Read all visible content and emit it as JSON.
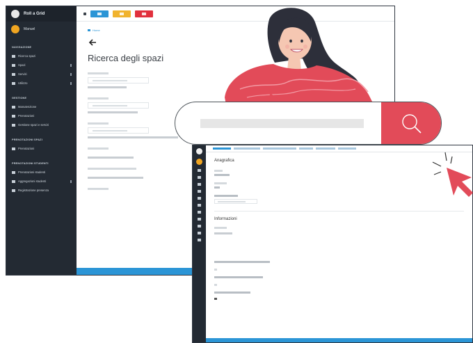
{
  "app": {
    "name": "Roll a Grid"
  },
  "user": {
    "name": "Manuel"
  },
  "sidebar": {
    "sections": [
      {
        "title": "NAVIGAZIONE",
        "items": [
          {
            "label": "Ricerca spazi"
          },
          {
            "label": "Spazi"
          },
          {
            "label": "Servizi"
          },
          {
            "label": "Utilizzo"
          }
        ]
      },
      {
        "title": "GESTIONE",
        "items": [
          {
            "label": "Manutenzione"
          },
          {
            "label": "Prenotazioni"
          },
          {
            "label": "Gestione spazi e servizi"
          }
        ]
      },
      {
        "title": "PRENOTAZIONI SPAZI",
        "items": [
          {
            "label": "Prenotazioni"
          }
        ]
      },
      {
        "title": "PRENOTAZIONI STUDENTI",
        "items": [
          {
            "label": "Prenotazioni studenti"
          },
          {
            "label": "Aggregazioni studenti"
          },
          {
            "label": "Registrazione presenza"
          }
        ]
      }
    ]
  },
  "toolbar": {
    "buttons": [
      {
        "color": "#2b95d6"
      },
      {
        "color": "#f0b32e"
      },
      {
        "color": "#e1303d"
      }
    ]
  },
  "page": {
    "breadcrumb": "Home",
    "title": "Ricerca degli spazi"
  },
  "detail": {
    "section1_title": "Anagrafica",
    "section2_title": "Informazioni"
  },
  "colors": {
    "sidebar": "#232a33",
    "accent": "#2b95d6",
    "search_button": "#e24b59",
    "shirt": "#e24b59"
  },
  "icons": {
    "search": "search-icon",
    "cursor": "pointer-cursor-icon",
    "back": "arrow-left-icon"
  }
}
